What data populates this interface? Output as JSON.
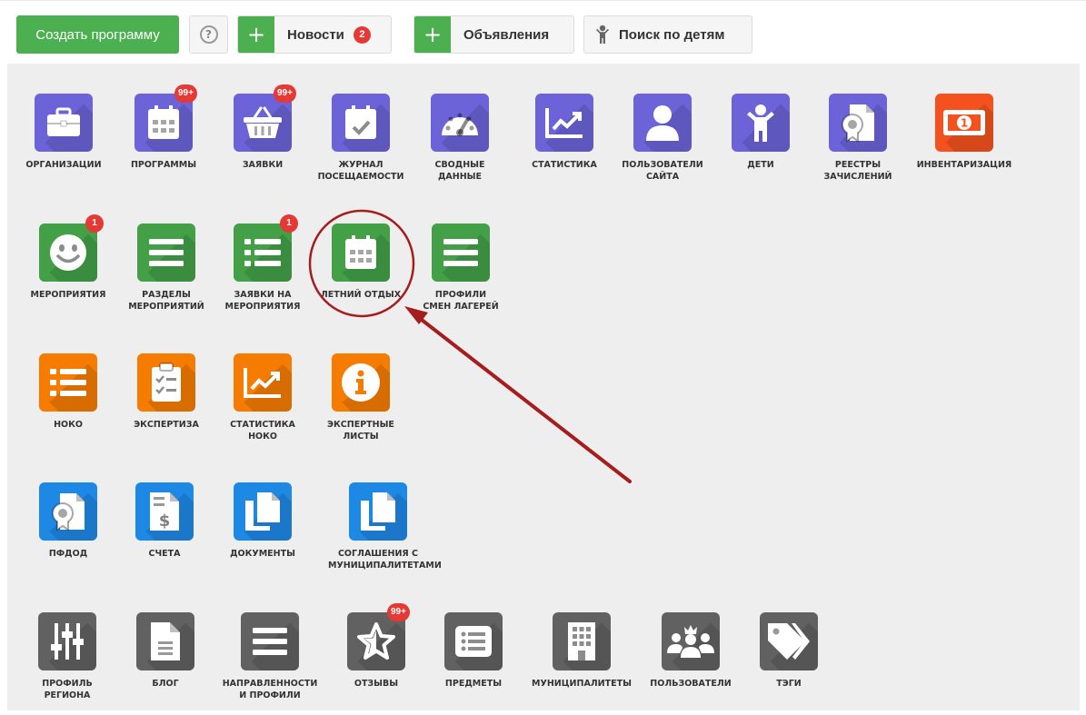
{
  "toolbar": {
    "create_label": "Создать программу",
    "help_symbol": "?",
    "news": {
      "plus": "+",
      "label": "Новости",
      "badge": "2"
    },
    "ads": {
      "plus": "+",
      "label": "Объявления"
    },
    "search": {
      "label": "Поиск по детям"
    }
  },
  "colors": {
    "purple": "#6c63d8",
    "orangered": "#f4511e",
    "green": "#43a047",
    "orange": "#f57c00",
    "blue": "#1e88e5",
    "gray": "#616161",
    "badge": "#e53935",
    "annotation": "#a51d1d"
  },
  "rows": [
    [
      {
        "label": "ОРГАНИЗАЦИИ",
        "icon": "briefcase-icon",
        "color": "purple"
      },
      {
        "label": "ПРОГРАММЫ",
        "icon": "calendar-icon",
        "color": "purple",
        "badge": "99+"
      },
      {
        "label": "ЗАЯВКИ",
        "icon": "basket-icon",
        "color": "purple",
        "badge": "99+"
      },
      {
        "label": "ЖУРНАЛ\nПОСЕЩАЕМОСТИ",
        "icon": "calendar-check-icon",
        "color": "purple"
      },
      {
        "label": "СВОДНЫЕ\nДАННЫЕ",
        "icon": "gauge-icon",
        "color": "purple"
      },
      {
        "label": "СТАТИСТИКА",
        "icon": "chart-line-icon",
        "color": "purple"
      },
      {
        "label": "ПОЛЬЗОВАТЕЛИ\nСАЙТА",
        "icon": "user-icon",
        "color": "purple"
      },
      {
        "label": "ДЕТИ",
        "icon": "child-icon",
        "color": "purple"
      },
      {
        "label": "РЕЕСТРЫ\nЗАЧИСЛЕНИЙ",
        "icon": "certificate-icon",
        "color": "purple"
      },
      {
        "label": "ИНВЕНТАРИЗАЦИЯ",
        "icon": "money-bill-icon",
        "color": "orangered"
      }
    ],
    [
      {
        "label": "МЕРОПРИЯТИЯ",
        "icon": "smile-icon",
        "color": "green",
        "badge": "1"
      },
      {
        "label": "РАЗДЕЛЫ\nМЕРОПРИЯТИЙ",
        "icon": "bars-icon",
        "color": "green"
      },
      {
        "label": "ЗАЯВКИ НА\nМЕРОПРИЯТИЯ",
        "icon": "list-icon",
        "color": "green",
        "badge": "1"
      },
      {
        "label": "ЛЕТНИЙ ОТДЫХ",
        "icon": "calendar-icon",
        "color": "green"
      },
      {
        "label": "ПРОФИЛИ\nСМЕН ЛАГЕРЕЙ",
        "icon": "bars-icon",
        "color": "green"
      }
    ],
    [
      {
        "label": "НОКО",
        "icon": "list-icon",
        "color": "orange"
      },
      {
        "label": "ЭКСПЕРТИЗА",
        "icon": "clipboard-check-icon",
        "color": "orange"
      },
      {
        "label": "СТАТИСТИКА\nНОКО",
        "icon": "chart-line-icon",
        "color": "orange"
      },
      {
        "label": "ЭКСПЕРТНЫЕ\nЛИСТЫ",
        "icon": "info-icon",
        "color": "orange"
      }
    ],
    [
      {
        "label": "ПФДОД",
        "icon": "certificate-icon",
        "color": "blue"
      },
      {
        "label": "СЧЕТА",
        "icon": "invoice-dollar-icon",
        "color": "blue"
      },
      {
        "label": "ДОКУМЕНТЫ",
        "icon": "copy-icon",
        "color": "blue"
      },
      {
        "label": "СОГЛАШЕНИЯ С\nМУНИЦИПАЛИТЕТАМИ",
        "icon": "copy-icon",
        "color": "blue"
      }
    ],
    [
      {
        "label": "ПРОФИЛЬ\nРЕГИОНА",
        "icon": "sliders-icon",
        "color": "gray"
      },
      {
        "label": "БЛОГ",
        "icon": "file-text-icon",
        "color": "gray"
      },
      {
        "label": "НАПРАВЛЕННОСТИ\nИ ПРОФИЛИ",
        "icon": "bars-icon",
        "color": "gray"
      },
      {
        "label": "ОТЗЫВЫ",
        "icon": "star-icon",
        "color": "gray",
        "badge": "99+"
      },
      {
        "label": "ПРЕДМЕТЫ",
        "icon": "list-alt-icon",
        "color": "gray"
      },
      {
        "label": "МУНИЦИПАЛИТЕТЫ",
        "icon": "building-icon",
        "color": "gray"
      },
      {
        "label": "ПОЛЬЗОВАТЕЛИ",
        "icon": "users-crown-icon",
        "color": "gray"
      },
      {
        "label": "ТЭГИ",
        "icon": "tags-icon",
        "color": "gray"
      }
    ]
  ]
}
